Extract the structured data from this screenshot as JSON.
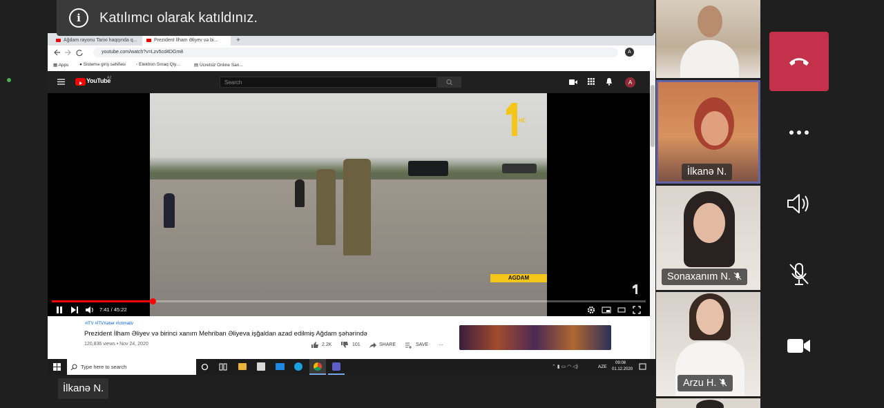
{
  "notification": {
    "text": "Katılımcı olarak katıldınız."
  },
  "shared_screen": {
    "tabs": [
      "Ağdam rayonu Tarixi haqqında q...",
      "Prezident İlham Əliyev və bi..."
    ],
    "url": "youtube.com/watch?v=Lzv5cd4DGm8",
    "bookmarks": [
      "Apps",
      "Sistemə giriş səhifəsi",
      "Elektron Sınaq Qiy...",
      "Ücretsiz Online San..."
    ],
    "youtube": {
      "logo_text": "YouTube",
      "logo_sup": "AZ",
      "search_placeholder": "Search",
      "avatar_letter": "A",
      "video": {
        "channel_logo": "HD",
        "location_caption": "AGDAM",
        "time": "7:41 / 45:22",
        "progress": 0.17
      },
      "hashtags": "#İTV #İTVXəbər #İctimaitv",
      "title": "Prezident İlham Əliyev və birinci xanım Mehriban Əliyeva işğaldan azad edilmiş Ağdam şəhərində",
      "meta": "120,836 views • Nov 24, 2020",
      "likes": "2.2K",
      "dislikes": "101",
      "share": "SHARE",
      "save": "SAVE",
      "more": "..."
    },
    "taskbar": {
      "search_placeholder": "Type here to search",
      "lang": "AZE",
      "time": "09:08",
      "date": "01.12.2020"
    }
  },
  "participants": [
    {
      "name": "",
      "muted": false,
      "active": false
    },
    {
      "name": "İlkanə N.",
      "muted": false,
      "active": true
    },
    {
      "name": "Sonaxanım N.",
      "muted": true,
      "active": false
    },
    {
      "name": "Arzu H.",
      "muted": true,
      "active": false
    },
    {
      "name": "",
      "muted": false,
      "active": false
    }
  ],
  "controls": [
    "hang-up",
    "more",
    "speaker",
    "microphone-muted",
    "camera"
  ],
  "presenter_name": "İlkanə N.",
  "colors": {
    "hangup": "#c4314b",
    "active_border": "#6264a7",
    "background": "#1f1f1f"
  }
}
